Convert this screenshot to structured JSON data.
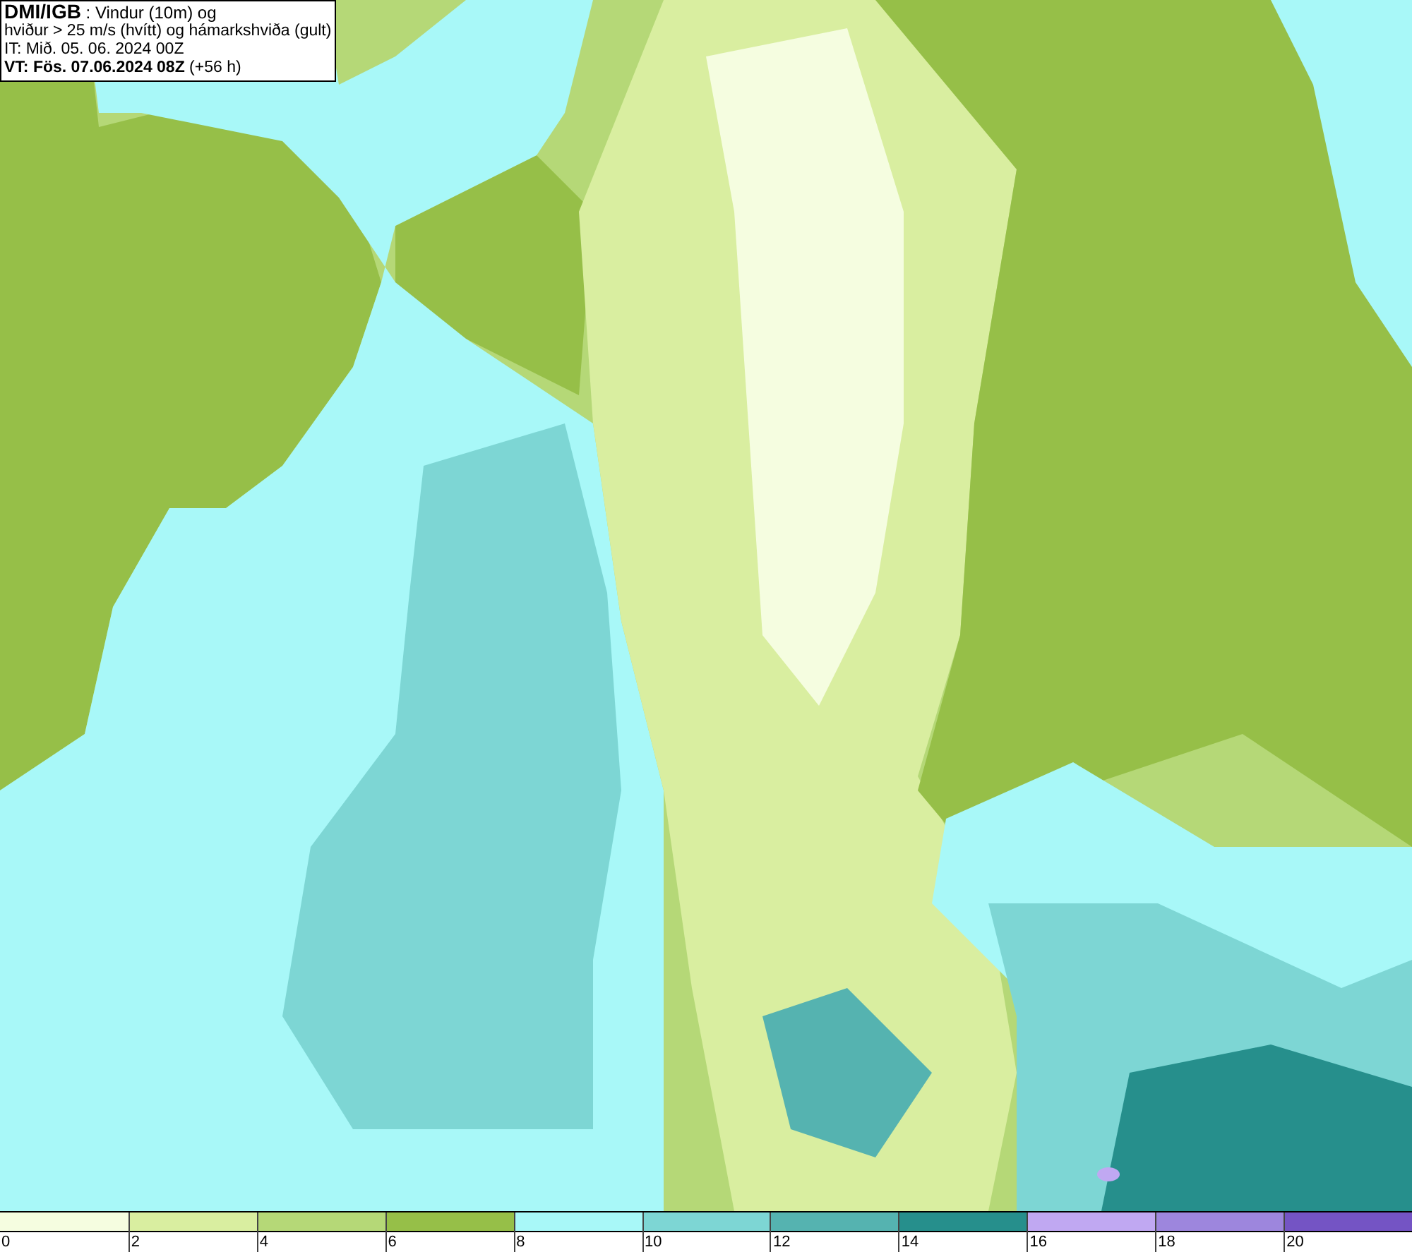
{
  "header": {
    "lines": [
      {
        "kind": "title",
        "text": "**DMI/IGB** : Vindur (10m) og"
      },
      {
        "kind": "plain",
        "text": "hviður > 25 m/s (hvítt) og hámarkshviða (gult)"
      },
      {
        "kind": "plain",
        "text": "IT: Mið. 05. 06. 2024 00Z"
      },
      {
        "kind": "plain",
        "text": "**VT: Fös. 07.06.2024 08Z** (+56 h)"
      }
    ]
  },
  "legend": {
    "bins": [
      {
        "label": "0",
        "color": "#f5fde0"
      },
      {
        "label": "2",
        "color": "#d9eea0"
      },
      {
        "label": "4",
        "color": "#b5d877"
      },
      {
        "label": "6",
        "color": "#96bf48"
      },
      {
        "label": "8",
        "color": "#a8f8f8"
      },
      {
        "label": "10",
        "color": "#7dd6d4"
      },
      {
        "label": "12",
        "color": "#55b3b0"
      },
      {
        "label": "14",
        "color": "#268f8c"
      },
      {
        "label": "16",
        "color": "#c0a8f2"
      },
      {
        "label": "18",
        "color": "#9d86dd"
      },
      {
        "label": "20",
        "color": "#7454c4"
      }
    ]
  }
}
